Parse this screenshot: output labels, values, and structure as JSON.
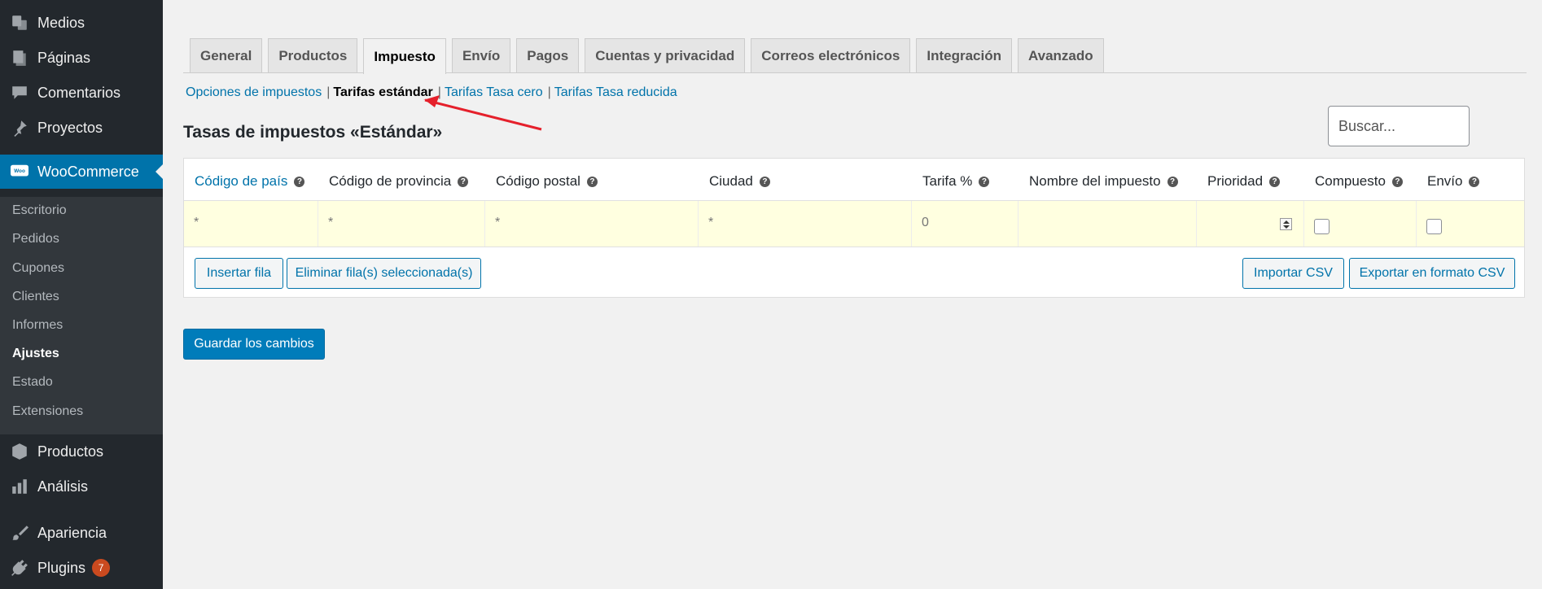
{
  "sidebar": {
    "top_items": [
      {
        "label": "Medios",
        "icon": "media-icon"
      },
      {
        "label": "Páginas",
        "icon": "pages-icon"
      },
      {
        "label": "Comentarios",
        "icon": "comments-icon"
      },
      {
        "label": "Proyectos",
        "icon": "pin-icon"
      }
    ],
    "woocommerce": {
      "label": "WooCommerce",
      "icon": "woo-icon"
    },
    "submenu": [
      "Escritorio",
      "Pedidos",
      "Cupones",
      "Clientes",
      "Informes",
      "Ajustes",
      "Estado",
      "Extensiones"
    ],
    "current_submenu": "Ajustes",
    "bottom_items": [
      {
        "label": "Productos",
        "icon": "box-icon"
      },
      {
        "label": "Análisis",
        "icon": "chart-icon"
      },
      {
        "label": "Apariencia",
        "icon": "brush-icon"
      },
      {
        "label": "Plugins",
        "icon": "plug-icon",
        "badge": "7"
      }
    ]
  },
  "tabs": [
    "General",
    "Productos",
    "Impuesto",
    "Envío",
    "Pagos",
    "Cuentas y privacidad",
    "Correos electrónicos",
    "Integración",
    "Avanzado"
  ],
  "active_tab": "Impuesto",
  "sub_nav": {
    "items": [
      "Opciones de impuestos",
      "Tarifas estándar",
      "Tarifas Tasa cero",
      "Tarifas Tasa reducida"
    ],
    "current": "Tarifas estándar"
  },
  "section_title": "Tasas de impuestos «Estándar»",
  "search": {
    "placeholder": "Buscar..."
  },
  "table": {
    "headers": [
      "Código de país",
      "Código de provincia",
      "Código postal",
      "Ciudad",
      "Tarifa %",
      "Nombre del impuesto",
      "Prioridad",
      "Compuesto",
      "Envío"
    ],
    "row": {
      "country": "*",
      "state": "*",
      "postcode": "*",
      "city": "*",
      "rate": "0",
      "name": "",
      "priority": "",
      "compound": false,
      "shipping": false
    }
  },
  "buttons": {
    "insert_row": "Insertar fila",
    "remove_rows": "Eliminar fila(s) seleccionada(s)",
    "import_csv": "Importar CSV",
    "export_csv": "Exportar en formato CSV",
    "save": "Guardar los cambios"
  },
  "colors": {
    "accent": "#0073aa",
    "sidebar": "#23282d",
    "annotation_arrow": "#e5202b"
  }
}
